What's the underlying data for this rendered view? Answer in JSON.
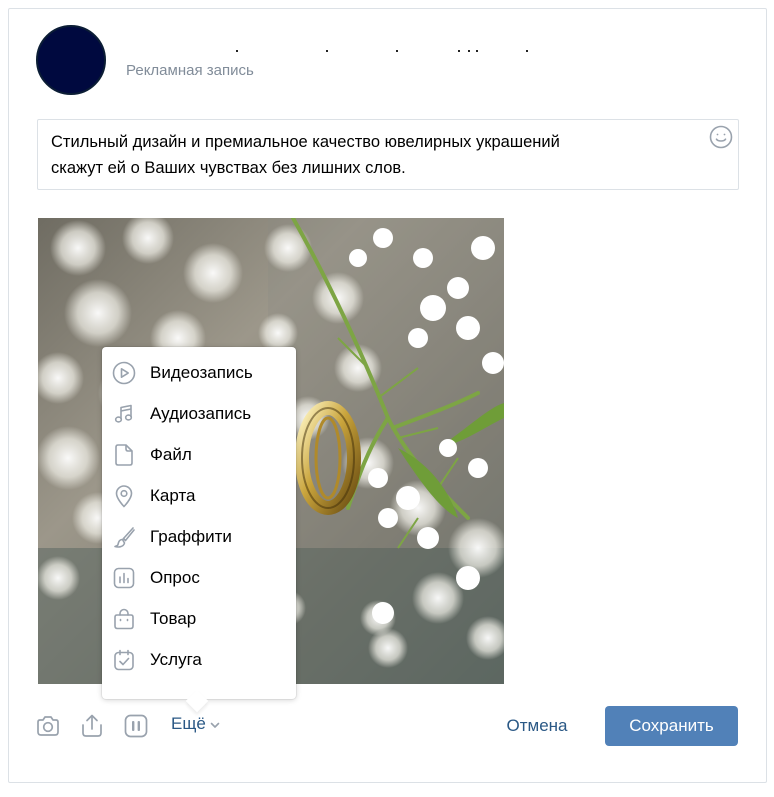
{
  "post": {
    "author_name": "",
    "subtitle": "Рекламная запись",
    "text_line1": "Стильный дизайн и премиальное качество ювелирных украшений",
    "text_line2": "скажут ей о Ваших чувствах без лишних слов."
  },
  "attach_menu": {
    "items": [
      {
        "label": "Видеозапись",
        "icon": "video-icon"
      },
      {
        "label": "Аудиозапись",
        "icon": "music-note-icon"
      },
      {
        "label": "Файл",
        "icon": "file-icon"
      },
      {
        "label": "Карта",
        "icon": "map-pin-icon"
      },
      {
        "label": "Граффити",
        "icon": "brush-icon"
      },
      {
        "label": "Опрос",
        "icon": "poll-icon"
      },
      {
        "label": "Товар",
        "icon": "shopping-bag-icon"
      },
      {
        "label": "Услуга",
        "icon": "service-calendar-icon"
      }
    ]
  },
  "toolbar": {
    "more_label": "Ещё",
    "cancel_label": "Отмена",
    "save_label": "Сохранить"
  },
  "colors": {
    "accent_button": "#5181b8",
    "link_text": "#2a5885",
    "icon_gray": "#99a2ad",
    "subtitle_gray": "#818c99",
    "avatar": "#00093f"
  }
}
